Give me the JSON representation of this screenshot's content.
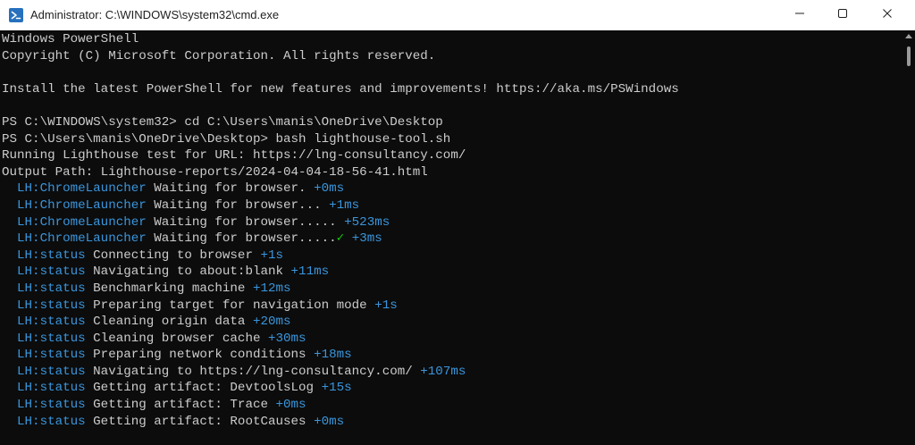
{
  "window": {
    "title": "Administrator:  C:\\WINDOWS\\system32\\cmd.exe",
    "icon": "powershell-icon",
    "controls": {
      "minimize": "minimize-icon",
      "maximize": "maximize-icon",
      "close": "close-icon"
    }
  },
  "console": {
    "header": [
      "Windows PowerShell",
      "Copyright (C) Microsoft Corporation. All rights reserved.",
      "",
      "Install the latest PowerShell for new features and improvements! https://aka.ms/PSWindows",
      "",
      "PS C:\\WINDOWS\\system32> cd C:\\Users\\manis\\OneDrive\\Desktop",
      "PS C:\\Users\\manis\\OneDrive\\Desktop> bash lighthouse-tool.sh",
      "Running Lighthouse test for URL: https://lng-consultancy.com/",
      "Output Path: Lighthouse-reports/2024-04-04-18-56-41.html"
    ],
    "log": [
      {
        "tag": "LH:ChromeLauncher",
        "msg": "Waiting for browser.",
        "check": "",
        "time": "+0ms"
      },
      {
        "tag": "LH:ChromeLauncher",
        "msg": "Waiting for browser...",
        "check": "",
        "time": "+1ms"
      },
      {
        "tag": "LH:ChromeLauncher",
        "msg": "Waiting for browser.....",
        "check": "",
        "time": "+523ms"
      },
      {
        "tag": "LH:ChromeLauncher",
        "msg": "Waiting for browser.....",
        "check": "✓",
        "time": "+3ms"
      },
      {
        "tag": "LH:status",
        "msg": "Connecting to browser",
        "check": "",
        "time": "+1s"
      },
      {
        "tag": "LH:status",
        "msg": "Navigating to about:blank",
        "check": "",
        "time": "+11ms"
      },
      {
        "tag": "LH:status",
        "msg": "Benchmarking machine",
        "check": "",
        "time": "+12ms"
      },
      {
        "tag": "LH:status",
        "msg": "Preparing target for navigation mode",
        "check": "",
        "time": "+1s"
      },
      {
        "tag": "LH:status",
        "msg": "Cleaning origin data",
        "check": "",
        "time": "+20ms"
      },
      {
        "tag": "LH:status",
        "msg": "Cleaning browser cache",
        "check": "",
        "time": "+30ms"
      },
      {
        "tag": "LH:status",
        "msg": "Preparing network conditions",
        "check": "",
        "time": "+18ms"
      },
      {
        "tag": "LH:status",
        "msg": "Navigating to https://lng-consultancy.com/",
        "check": "",
        "time": "+107ms"
      },
      {
        "tag": "LH:status",
        "msg": "Getting artifact: DevtoolsLog",
        "check": "",
        "time": "+15s"
      },
      {
        "tag": "LH:status",
        "msg": "Getting artifact: Trace",
        "check": "",
        "time": "+0ms"
      },
      {
        "tag": "LH:status",
        "msg": "Getting artifact: RootCauses",
        "check": "",
        "time": "+0ms"
      }
    ]
  },
  "colors": {
    "background": "#0c0c0c",
    "text": "#cccccc",
    "tag": "#3a96dd",
    "time": "#3a96dd",
    "check": "#16c60c"
  }
}
